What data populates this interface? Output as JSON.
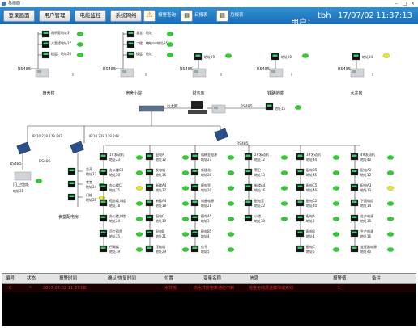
{
  "window": {
    "title": "总画面"
  },
  "toolbar": {
    "buttons": [
      "登录画面",
      "用户管理",
      "电能监控",
      "系统网络"
    ],
    "alarm_label": "报警查询",
    "daily_label": "日报表",
    "monthly_label": "月报表"
  },
  "header": {
    "user_label": "用户：",
    "user": "tbh",
    "date": "17/07/02",
    "time": "11:37:13"
  },
  "colors": {
    "ok": "#37c837",
    "warn": "#f0e030",
    "line": "#333333",
    "alarm_text": "#e03030"
  },
  "groups": {
    "top": [
      {
        "bus": "RS485",
        "name": "宿舍楼",
        "meters": [
          {
            "label": "照明室",
            "addr": "地址3"
          },
          {
            "label": "大宽楼",
            "addr": "地址27"
          },
          {
            "label": "楼层",
            "addr": "地址26"
          }
        ]
      },
      {
        "bus": "RS485",
        "name": "宿舍小院",
        "meters": [
          {
            "label": "食堂",
            "addr": "地址"
          },
          {
            "label": "二楼",
            "addr": "地址"
          },
          {
            "label": "楼层",
            "addr": "地址"
          }
        ],
        "side": "地址35"
      },
      {
        "bus": "RS485",
        "name": "财务库",
        "meters": [
          {
            "label": "",
            "addr": "地址29"
          }
        ]
      },
      {
        "bus": "RS485",
        "name": "铁路桥楼",
        "meters": [
          {
            "label": "",
            "addr": "地址20"
          }
        ]
      },
      {
        "bus": "RS485",
        "name": "水井房",
        "meters": [
          {
            "label": "",
            "addr": "地址34"
          }
        ]
      }
    ],
    "hub_label": "以太网",
    "rs485_mid": "RS485",
    "mid_addr": "地址15",
    "ip1": "IP:10.228.179.247",
    "ip2": "IP:10.228.179.248",
    "left_group": {
      "bus": "RS485",
      "name": "门卫值班",
      "addr": "地址31"
    },
    "left2_group": {
      "bus": "RS485",
      "name": "食堂配电房",
      "meters": [
        {
          "label": "总开",
          "addr": "地址22"
        },
        {
          "label": "食堂",
          "addr": "地址24"
        },
        {
          "label": "门栋",
          "addr": "地址25"
        }
      ]
    },
    "columns": [
      {
        "items": [
          {
            "label": "1#发动机",
            "addr": "地址23"
          },
          {
            "label": "办公楼C4",
            "addr": "地址28"
          },
          {
            "label": "办公楼C",
            "addr": "地址25"
          },
          {
            "label": "宿舍楼大楼",
            "addr": "地址18"
          },
          {
            "label": "办公楼大楼",
            "addr": "地址24"
          },
          {
            "label": "员工宿舍",
            "addr": "地址25"
          },
          {
            "label": "行政楼",
            "addr": "地址19"
          }
        ]
      },
      {
        "items": [
          {
            "label": "配电A",
            "addr": "地址12"
          },
          {
            "label": "发电机",
            "addr": "地址16"
          },
          {
            "label": "新楼A4",
            "addr": "地址17"
          },
          {
            "label": "新楼A4",
            "addr": "地址18"
          },
          {
            "label": "配电C",
            "addr": "地址19"
          },
          {
            "label": "配电B",
            "addr": "地址21"
          },
          {
            "label": "压缩机",
            "addr": "地址29"
          }
        ]
      },
      {
        "items": [
          {
            "label": "机械室电源",
            "addr": "地址27"
          },
          {
            "label": "新楼北",
            "addr": "地址20"
          },
          {
            "label": "配电室",
            "addr": "地址20"
          },
          {
            "label": "储备电源",
            "addr": "地址21"
          },
          {
            "label": "配电A5",
            "addr": "地址3"
          },
          {
            "label": "配电B5",
            "addr": "地址4"
          },
          {
            "label": "信号",
            "addr": "地址5"
          }
        ]
      },
      {
        "items": [
          {
            "label": "2#发动机",
            "addr": "地址12"
          },
          {
            "label": "警卫",
            "addr": "地址13"
          },
          {
            "label": "新楼A4",
            "addr": "地址16"
          },
          {
            "label": "配电室",
            "addr": "地址22"
          },
          {
            "label": "小楼",
            "addr": "地址30"
          }
        ]
      },
      {
        "items": [
          {
            "label": "3#发动机",
            "addr": "地址44"
          },
          {
            "label": "配电B5",
            "addr": "地址45"
          },
          {
            "label": "配电C5",
            "addr": "地址46"
          },
          {
            "label": "配电C2",
            "addr": "地址40"
          },
          {
            "label": "配电A",
            "addr": "地址3"
          },
          {
            "label": "配电B",
            "addr": "地址4"
          },
          {
            "label": "配电C",
            "addr": "地址5"
          }
        ]
      },
      {
        "items": [
          {
            "label": "4#发动机",
            "addr": "地址40"
          },
          {
            "label": "配电A2",
            "addr": "地址12"
          },
          {
            "label": "配电A3",
            "addr": "地址13"
          },
          {
            "label": "下面机组",
            "addr": "地址14"
          },
          {
            "label": "生产电源",
            "addr": "地址15"
          },
          {
            "label": "生产电源",
            "addr": "地址16"
          },
          {
            "label": "变压器电源",
            "addr": "地址40"
          }
        ]
      }
    ]
  },
  "events": {
    "headers": [
      "编号",
      "状态",
      "报警时间",
      "确认/恢复时间",
      "位置",
      "变量名称",
      "信息",
      "报警值",
      "备注"
    ],
    "rows": [
      {
        "no": "0",
        "state": "*",
        "time": "2017-07-02 11:37:08",
        "ack": "",
        "pos": "水井房",
        "var": "向水井房电表通信中断",
        "info": "检查无线发送模块或天线",
        "val": "1",
        "note": ""
      }
    ]
  }
}
